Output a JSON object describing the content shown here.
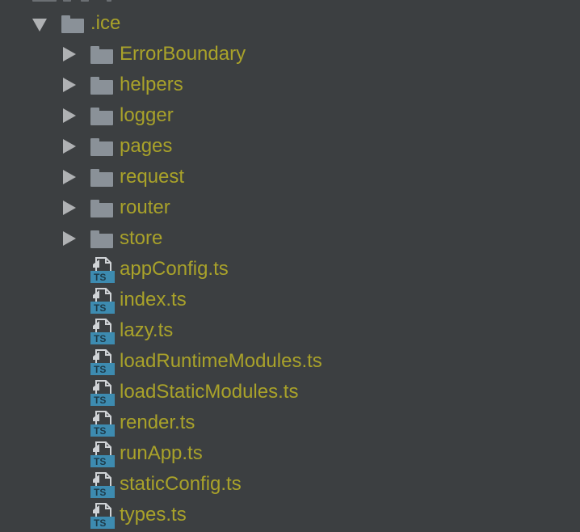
{
  "tree": {
    "root": {
      "name": ".ice",
      "expanded": true,
      "icon": "folder-icon"
    },
    "folders": [
      {
        "name": "ErrorBoundary",
        "icon": "folder-icon",
        "expanded": false
      },
      {
        "name": "helpers",
        "icon": "folder-icon",
        "expanded": false
      },
      {
        "name": "logger",
        "icon": "folder-icon",
        "expanded": false
      },
      {
        "name": "pages",
        "icon": "folder-icon",
        "expanded": false
      },
      {
        "name": "request",
        "icon": "folder-icon",
        "expanded": false
      },
      {
        "name": "router",
        "icon": "folder-icon",
        "expanded": false
      },
      {
        "name": "store",
        "icon": "folder-icon",
        "expanded": false
      }
    ],
    "files": [
      {
        "name": "appConfig.ts",
        "icon": "typescript-file-icon"
      },
      {
        "name": "index.ts",
        "icon": "typescript-file-icon"
      },
      {
        "name": "lazy.ts",
        "icon": "typescript-file-icon"
      },
      {
        "name": "loadRuntimeModules.ts",
        "icon": "typescript-file-icon"
      },
      {
        "name": "loadStaticModules.ts",
        "icon": "typescript-file-icon"
      },
      {
        "name": "render.ts",
        "icon": "typescript-file-icon"
      },
      {
        "name": "runApp.ts",
        "icon": "typescript-file-icon"
      },
      {
        "name": "staticConfig.ts",
        "icon": "typescript-file-icon"
      },
      {
        "name": "types.ts",
        "icon": "typescript-file-icon"
      }
    ],
    "ts_badge": "TS"
  },
  "colors": {
    "background": "#3c3f41",
    "label": "#a9a22a",
    "folder": "#8a9198",
    "arrow": "#afb1b3",
    "ts_badge": "#3d8bb0"
  }
}
